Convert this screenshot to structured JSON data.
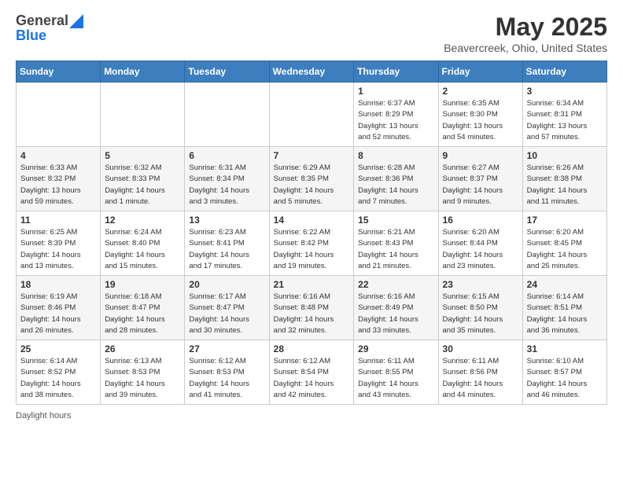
{
  "header": {
    "logo_general": "General",
    "logo_blue": "Blue",
    "month_title": "May 2025",
    "location": "Beavercreek, Ohio, United States"
  },
  "days_of_week": [
    "Sunday",
    "Monday",
    "Tuesday",
    "Wednesday",
    "Thursday",
    "Friday",
    "Saturday"
  ],
  "weeks": [
    [
      {
        "day": "",
        "info": ""
      },
      {
        "day": "",
        "info": ""
      },
      {
        "day": "",
        "info": ""
      },
      {
        "day": "",
        "info": ""
      },
      {
        "day": "1",
        "info": "Sunrise: 6:37 AM\nSunset: 8:29 PM\nDaylight: 13 hours\nand 52 minutes."
      },
      {
        "day": "2",
        "info": "Sunrise: 6:35 AM\nSunset: 8:30 PM\nDaylight: 13 hours\nand 54 minutes."
      },
      {
        "day": "3",
        "info": "Sunrise: 6:34 AM\nSunset: 8:31 PM\nDaylight: 13 hours\nand 57 minutes."
      }
    ],
    [
      {
        "day": "4",
        "info": "Sunrise: 6:33 AM\nSunset: 8:32 PM\nDaylight: 13 hours\nand 59 minutes."
      },
      {
        "day": "5",
        "info": "Sunrise: 6:32 AM\nSunset: 8:33 PM\nDaylight: 14 hours\nand 1 minute."
      },
      {
        "day": "6",
        "info": "Sunrise: 6:31 AM\nSunset: 8:34 PM\nDaylight: 14 hours\nand 3 minutes."
      },
      {
        "day": "7",
        "info": "Sunrise: 6:29 AM\nSunset: 8:35 PM\nDaylight: 14 hours\nand 5 minutes."
      },
      {
        "day": "8",
        "info": "Sunrise: 6:28 AM\nSunset: 8:36 PM\nDaylight: 14 hours\nand 7 minutes."
      },
      {
        "day": "9",
        "info": "Sunrise: 6:27 AM\nSunset: 8:37 PM\nDaylight: 14 hours\nand 9 minutes."
      },
      {
        "day": "10",
        "info": "Sunrise: 6:26 AM\nSunset: 8:38 PM\nDaylight: 14 hours\nand 11 minutes."
      }
    ],
    [
      {
        "day": "11",
        "info": "Sunrise: 6:25 AM\nSunset: 8:39 PM\nDaylight: 14 hours\nand 13 minutes."
      },
      {
        "day": "12",
        "info": "Sunrise: 6:24 AM\nSunset: 8:40 PM\nDaylight: 14 hours\nand 15 minutes."
      },
      {
        "day": "13",
        "info": "Sunrise: 6:23 AM\nSunset: 8:41 PM\nDaylight: 14 hours\nand 17 minutes."
      },
      {
        "day": "14",
        "info": "Sunrise: 6:22 AM\nSunset: 8:42 PM\nDaylight: 14 hours\nand 19 minutes."
      },
      {
        "day": "15",
        "info": "Sunrise: 6:21 AM\nSunset: 8:43 PM\nDaylight: 14 hours\nand 21 minutes."
      },
      {
        "day": "16",
        "info": "Sunrise: 6:20 AM\nSunset: 8:44 PM\nDaylight: 14 hours\nand 23 minutes."
      },
      {
        "day": "17",
        "info": "Sunrise: 6:20 AM\nSunset: 8:45 PM\nDaylight: 14 hours\nand 25 minutes."
      }
    ],
    [
      {
        "day": "18",
        "info": "Sunrise: 6:19 AM\nSunset: 8:46 PM\nDaylight: 14 hours\nand 26 minutes."
      },
      {
        "day": "19",
        "info": "Sunrise: 6:18 AM\nSunset: 8:47 PM\nDaylight: 14 hours\nand 28 minutes."
      },
      {
        "day": "20",
        "info": "Sunrise: 6:17 AM\nSunset: 8:47 PM\nDaylight: 14 hours\nand 30 minutes."
      },
      {
        "day": "21",
        "info": "Sunrise: 6:16 AM\nSunset: 8:48 PM\nDaylight: 14 hours\nand 32 minutes."
      },
      {
        "day": "22",
        "info": "Sunrise: 6:16 AM\nSunset: 8:49 PM\nDaylight: 14 hours\nand 33 minutes."
      },
      {
        "day": "23",
        "info": "Sunrise: 6:15 AM\nSunset: 8:50 PM\nDaylight: 14 hours\nand 35 minutes."
      },
      {
        "day": "24",
        "info": "Sunrise: 6:14 AM\nSunset: 8:51 PM\nDaylight: 14 hours\nand 36 minutes."
      }
    ],
    [
      {
        "day": "25",
        "info": "Sunrise: 6:14 AM\nSunset: 8:52 PM\nDaylight: 14 hours\nand 38 minutes."
      },
      {
        "day": "26",
        "info": "Sunrise: 6:13 AM\nSunset: 8:53 PM\nDaylight: 14 hours\nand 39 minutes."
      },
      {
        "day": "27",
        "info": "Sunrise: 6:12 AM\nSunset: 8:53 PM\nDaylight: 14 hours\nand 41 minutes."
      },
      {
        "day": "28",
        "info": "Sunrise: 6:12 AM\nSunset: 8:54 PM\nDaylight: 14 hours\nand 42 minutes."
      },
      {
        "day": "29",
        "info": "Sunrise: 6:11 AM\nSunset: 8:55 PM\nDaylight: 14 hours\nand 43 minutes."
      },
      {
        "day": "30",
        "info": "Sunrise: 6:11 AM\nSunset: 8:56 PM\nDaylight: 14 hours\nand 44 minutes."
      },
      {
        "day": "31",
        "info": "Sunrise: 6:10 AM\nSunset: 8:57 PM\nDaylight: 14 hours\nand 46 minutes."
      }
    ]
  ],
  "footer": {
    "daylight_label": "Daylight hours"
  }
}
